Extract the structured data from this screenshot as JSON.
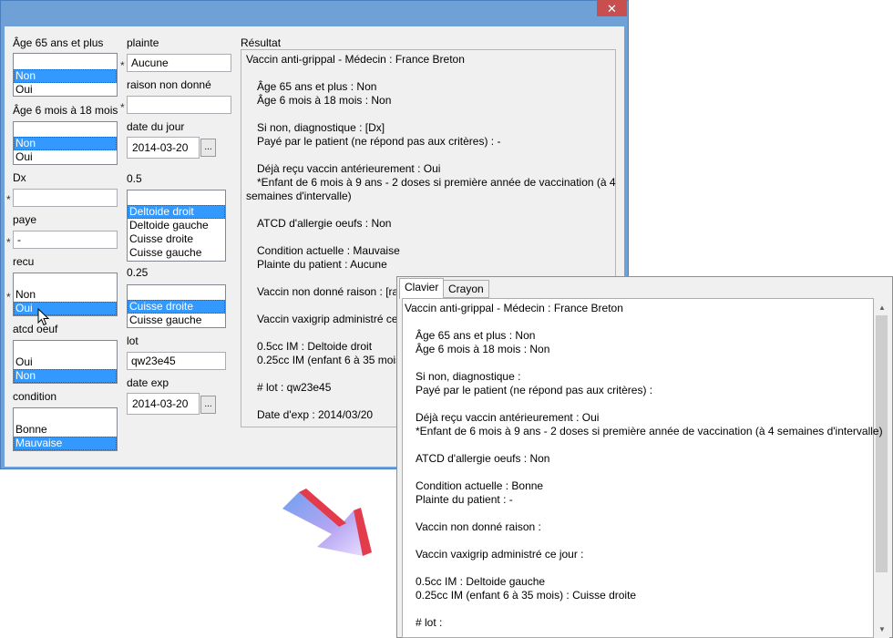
{
  "main_window": {
    "close_glyph": "✕",
    "age65": {
      "label": "Âge 65 ans et plus",
      "items": [
        "Non",
        "Oui"
      ],
      "selected": 0
    },
    "age6": {
      "label": "Âge 6 mois à 18 mois",
      "items": [
        "Non",
        "Oui"
      ],
      "selected": 0
    },
    "dx": {
      "label": "Dx",
      "value": ""
    },
    "paye": {
      "label": "paye",
      "value": "-"
    },
    "recu": {
      "label": "recu",
      "items": [
        "Non",
        "Oui"
      ],
      "selected": 1
    },
    "atcd": {
      "label": "atcd oeuf",
      "items": [
        "Oui",
        "Non"
      ],
      "selected": 1
    },
    "condition": {
      "label": "condition",
      "items": [
        "Bonne",
        "Mauvaise"
      ],
      "selected": 1
    },
    "plainte": {
      "label": "plainte",
      "value": "Aucune"
    },
    "raison": {
      "label": "raison non donné",
      "value": ""
    },
    "date_jour": {
      "label": "date du jour",
      "value": "2014-03-20",
      "button": "..."
    },
    "site05": {
      "label": "0.5",
      "items": [
        "Deltoide droit",
        "Deltoide gauche",
        "Cuisse droite",
        "Cuisse gauche"
      ],
      "selected": 0
    },
    "site025": {
      "label": "0.25",
      "items": [
        "Cuisse droite",
        "Cuisse gauche"
      ],
      "selected": 0
    },
    "lot": {
      "label": "lot",
      "value": "qw23e45"
    },
    "date_exp": {
      "label": "date exp",
      "value": "2014-03-20",
      "button": "..."
    },
    "required_mark": "*",
    "result": {
      "label": "Résultat",
      "lines": [
        "Vaccin anti-grippal - Médecin : France Breton",
        "Âge 65 ans et plus : Non",
        "Âge 6 mois à 18 mois : Non",
        "Si non, diagnostique : [Dx]",
        "Payé par le patient (ne répond pas aux critères)  : -",
        "Déjà reçu vaccin antérieurement : Oui",
        "*Enfant de 6 mois à 9 ans - 2 doses si première année de vaccination (à 4",
        "semaines d'intervalle)",
        "ATCD d'allergie oeufs : Non",
        "Condition actuelle : Mauvaise",
        "Plainte du patient : Aucune",
        "Vaccin non donné raison : [ra",
        "Vaccin vaxigrip administré ce",
        "0.5cc IM : Deltoide droit",
        "0.25cc IM (enfant 6 à 35 mois",
        "# lot : qw23e45",
        "Date d'exp : 2014/03/20"
      ]
    }
  },
  "second_window": {
    "tabs": [
      "Clavier",
      "Crayon"
    ],
    "active_tab": 0,
    "lines": [
      "Vaccin anti-grippal - Médecin : France Breton",
      "Âge 65 ans et plus : Non",
      "Âge 6 mois à 18 mois : Non",
      "Si non, diagnostique :",
      "Payé par le patient (ne répond pas aux critères)  :",
      "Déjà reçu vaccin antérieurement : Oui",
      "*Enfant de 6 mois à 9 ans - 2 doses si première année de vaccination (à 4 semaines d'intervalle)",
      "ATCD d'allergie oeufs : Non",
      "Condition actuelle : Bonne",
      "Plainte du patient : -",
      "Vaccin non donné raison :",
      "Vaccin vaxigrip administré ce jour :",
      "0.5cc IM : Deltoide gauche",
      "0.25cc IM (enfant 6 à 35 mois) :  Cuisse droite",
      "# lot :"
    ]
  }
}
